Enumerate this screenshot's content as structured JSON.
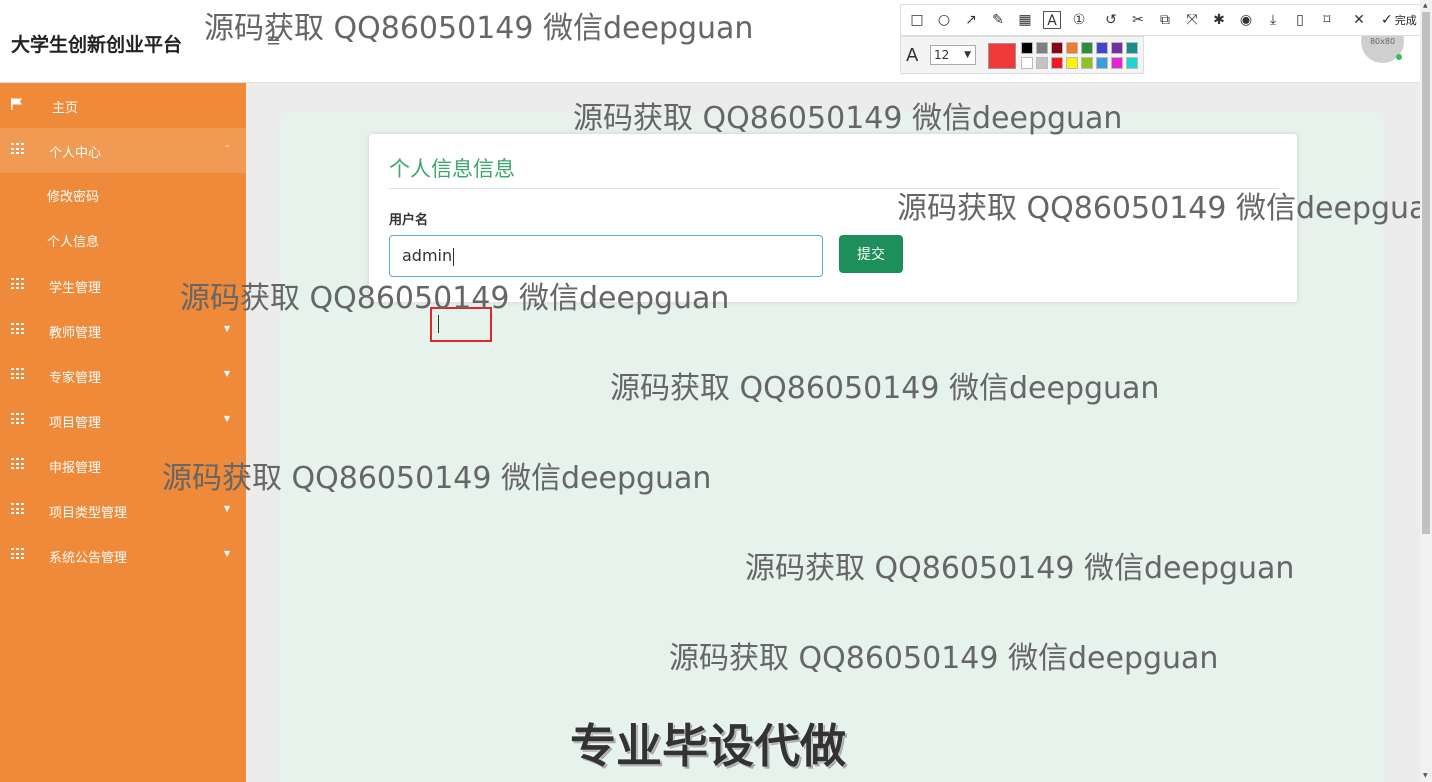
{
  "header": {
    "brand": "大学生创新创业平台",
    "menu_toggle_glyph": "≡",
    "avatar_text": "80x80"
  },
  "sidebar": {
    "items": [
      {
        "label": "主页",
        "icon": "flag-icon",
        "expanded": false,
        "has_caret": false
      },
      {
        "label": "个人中心",
        "icon": "grid-icon",
        "expanded": true,
        "has_caret": true,
        "caret": "⌃",
        "children": [
          {
            "label": "修改密码"
          },
          {
            "label": "个人信息"
          }
        ]
      },
      {
        "label": "学生管理",
        "icon": "grid-icon",
        "has_caret": false
      },
      {
        "label": "教师管理",
        "icon": "grid-icon",
        "has_caret": true,
        "caret": "▼"
      },
      {
        "label": "专家管理",
        "icon": "grid-icon",
        "has_caret": true,
        "caret": "▼"
      },
      {
        "label": "项目管理",
        "icon": "grid-icon",
        "has_caret": true,
        "caret": "▼"
      },
      {
        "label": "申报管理",
        "icon": "grid-icon",
        "has_caret": false
      },
      {
        "label": "项目类型管理",
        "icon": "grid-icon",
        "has_caret": true,
        "caret": "▼"
      },
      {
        "label": "系统公告管理",
        "icon": "grid-icon",
        "has_caret": true,
        "caret": "▼"
      }
    ]
  },
  "form": {
    "title": "个人信息信息",
    "username_label": "用户名",
    "username_value": "admin",
    "submit_label": "提交"
  },
  "screenshot_tool": {
    "done_label": "完成",
    "font_size": "12",
    "current_color": "#f03a3a",
    "palette_top": [
      "#000000",
      "#7f7f7f",
      "#880015",
      "#ed7d31",
      "#2e8b3e",
      "#3f48cc",
      "#7030a0",
      "#138d8d"
    ],
    "palette_bottom": [
      "#ffffff",
      "#c3c3c3",
      "#ed1c24",
      "#fff200",
      "#8dc21f",
      "#3b9ddd",
      "#e028d0",
      "#22d3d3"
    ]
  },
  "watermarks": {
    "text": "源码获取 QQ86050149 微信deepguan",
    "bottom_text": "专业毕设代做"
  },
  "colors": {
    "sidebar_bg": "#ee8a39",
    "accent_green": "#1d8f5a",
    "title_green": "#3ea86b"
  }
}
